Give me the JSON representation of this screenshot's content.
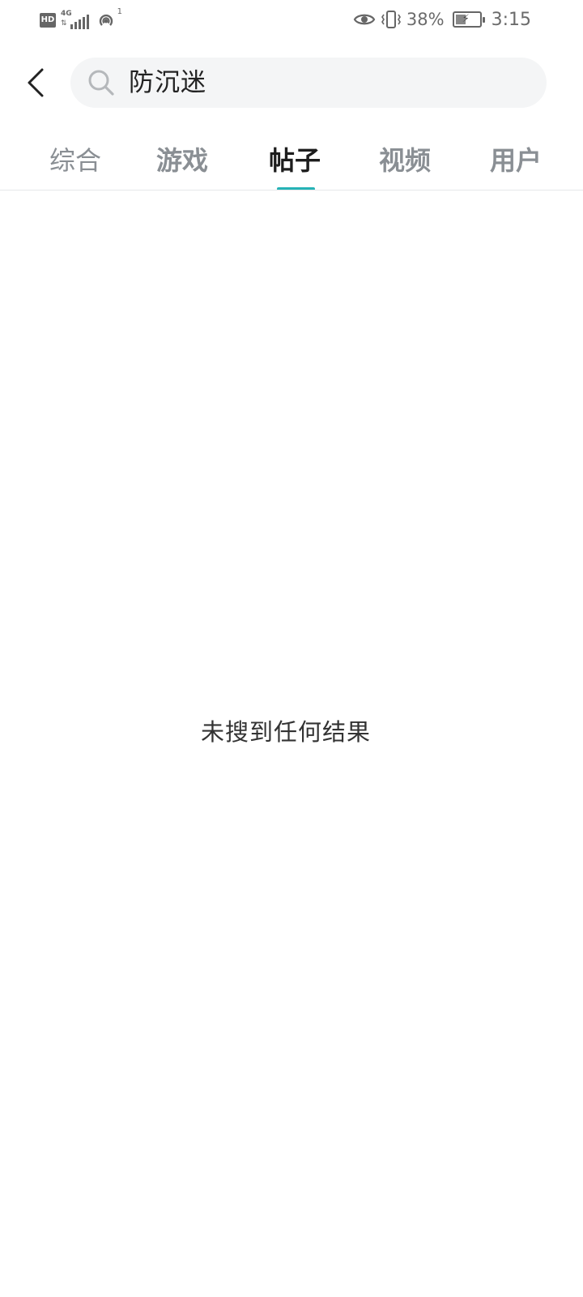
{
  "status_bar": {
    "hd_badge": "HD",
    "network": "4G",
    "hotspot_count": "1",
    "battery_percent": "38%",
    "battery_level": 0.38,
    "time": "3:15",
    "icons": [
      "hd-icon",
      "signal-icon",
      "hotspot-icon",
      "eye-icon",
      "vibrate-icon",
      "battery-icon"
    ]
  },
  "header": {
    "back_icon": "chevron-left-icon",
    "search": {
      "icon": "search-icon",
      "query": "防沉迷"
    }
  },
  "tabs": [
    {
      "label": "综合",
      "active": false
    },
    {
      "label": "游戏",
      "active": false
    },
    {
      "label": "帖子",
      "active": true
    },
    {
      "label": "视频",
      "active": false
    },
    {
      "label": "用户",
      "active": false
    }
  ],
  "empty_state": {
    "message": "未搜到任何结果"
  },
  "colors": {
    "accent": "#26b3b6",
    "search_bg": "#f4f5f6",
    "tab_inactive": "#8a8f94",
    "tab_active": "#1d1d1d"
  }
}
